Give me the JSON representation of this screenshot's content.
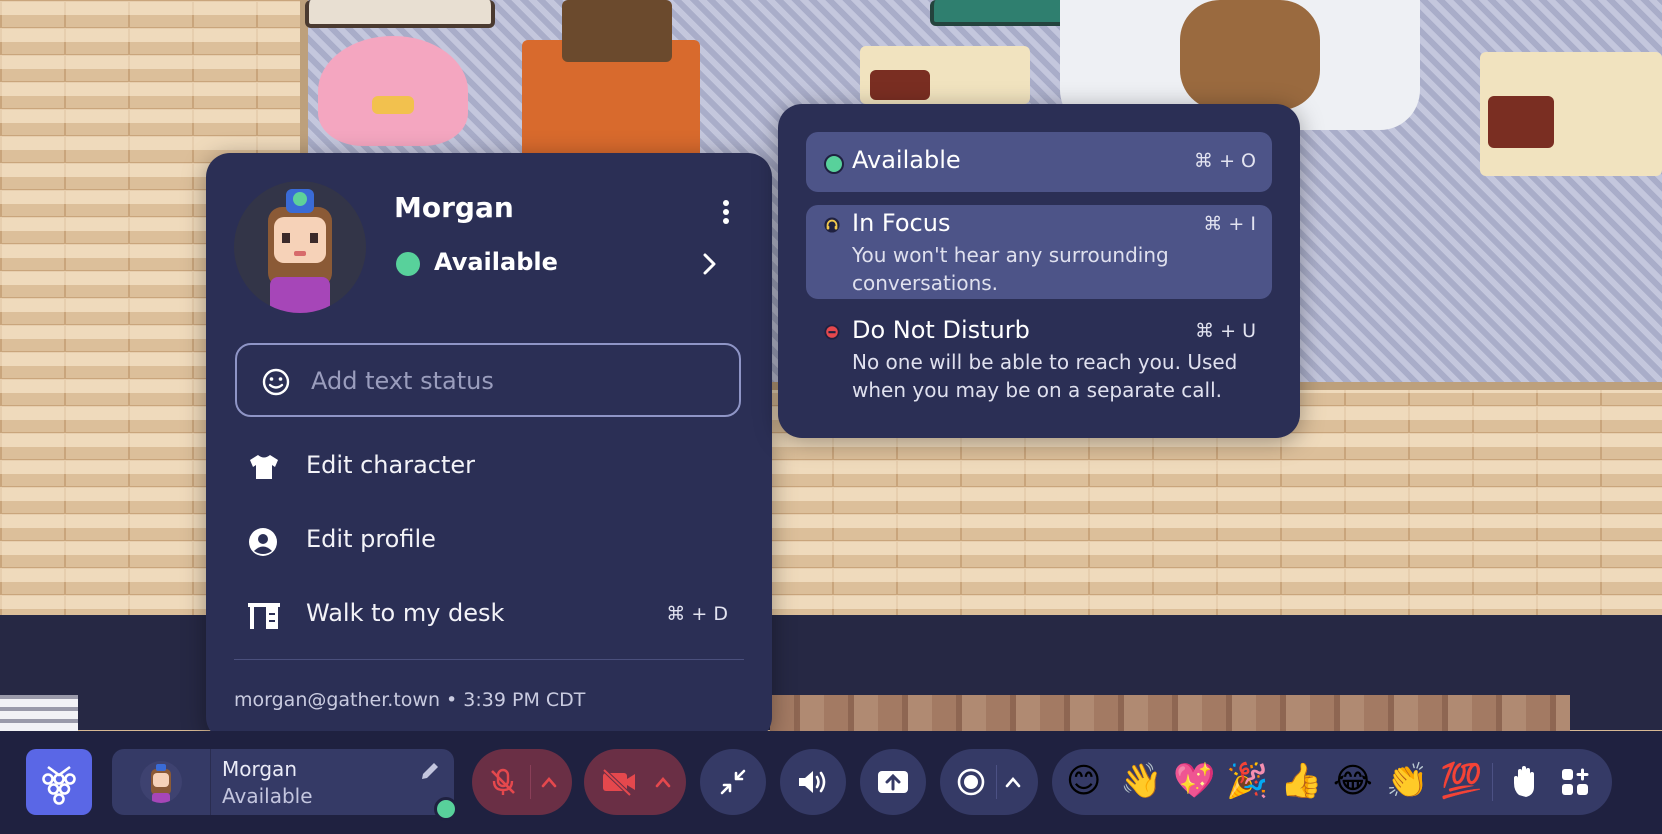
{
  "profile": {
    "name": "Morgan",
    "status": "Available",
    "text_status_placeholder": "Add text status",
    "menu": [
      {
        "label": "Edit character",
        "icon": "shirt-icon"
      },
      {
        "label": "Edit profile",
        "icon": "user-circle-icon"
      },
      {
        "label": "Walk to my desk",
        "icon": "desk-icon",
        "shortcut": "⌘ + D"
      }
    ],
    "footer": "morgan@gather.town • 3:39 PM CDT"
  },
  "status_menu": {
    "options": [
      {
        "label": "Available",
        "shortcut": "⌘ + O",
        "color": "#58d19b",
        "icon": "status-dot-icon"
      },
      {
        "label": "In Focus",
        "shortcut": "⌘ + I",
        "description": "You won't hear any surrounding conversations.",
        "color": "#f2c94c",
        "icon": "headphones-icon"
      },
      {
        "label": "Do Not Disturb",
        "shortcut": "⌘ + U",
        "description": "No one will be able to reach you. Used when you may be on a separate call.",
        "color": "#e5484d",
        "icon": "minus-circle-icon"
      }
    ]
  },
  "toolbar": {
    "user_name": "Morgan",
    "user_status": "Available",
    "emojis": [
      "😊",
      "👋",
      "💖",
      "🎉",
      "👍",
      "😂",
      "👏",
      "💯"
    ]
  },
  "colors": {
    "panel": "#2b2f55",
    "accent": "#5a67e6",
    "available": "#58d19b",
    "muted_red": "#6a2f45"
  }
}
